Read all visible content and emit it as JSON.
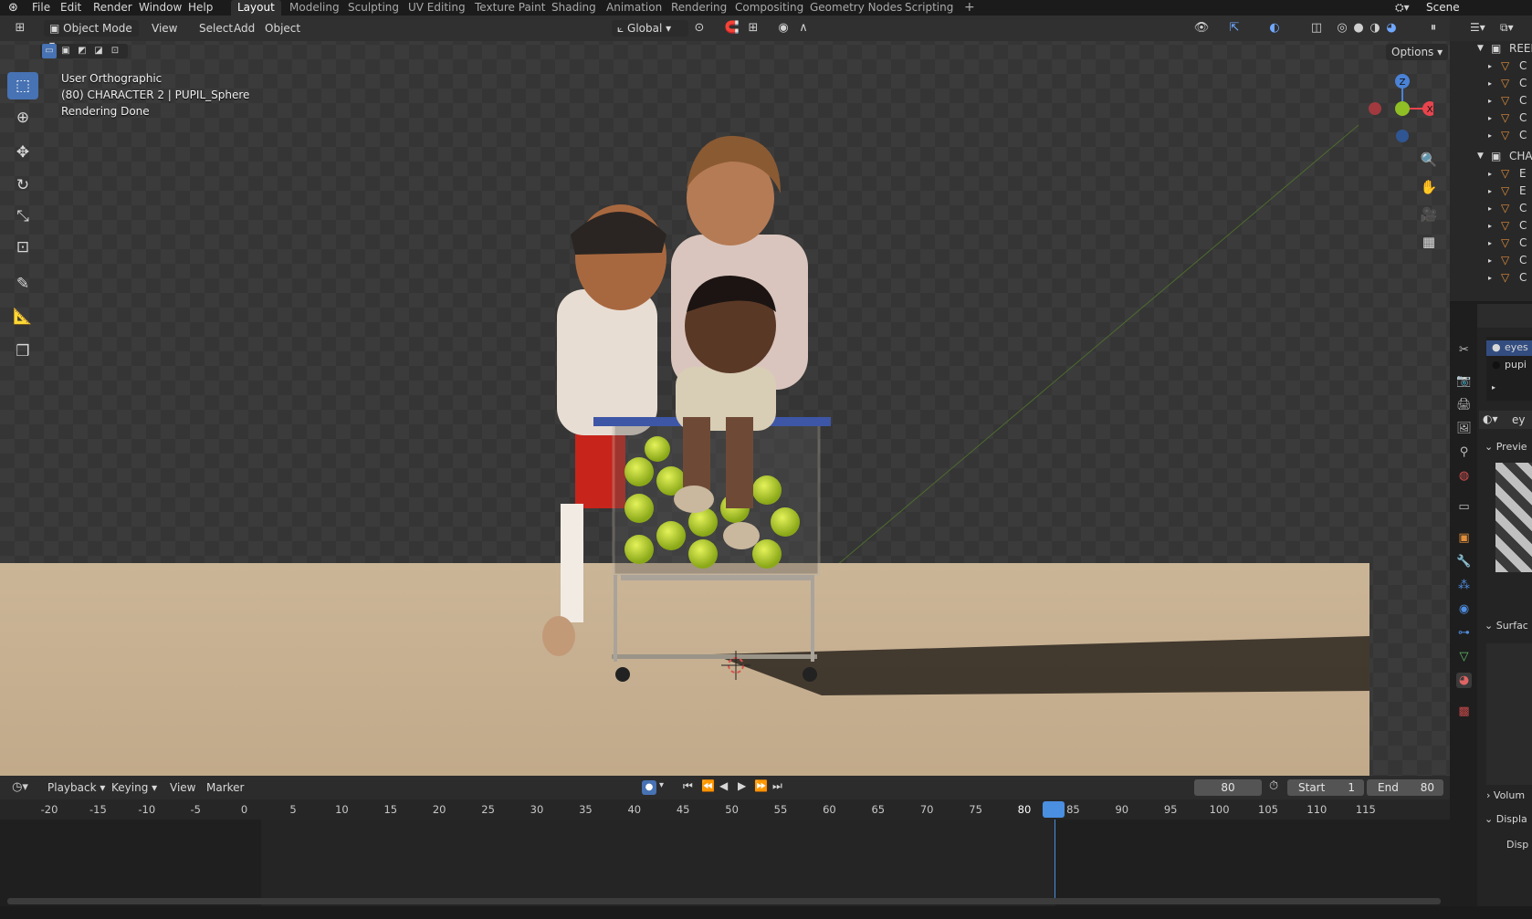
{
  "top_menu": {
    "items": [
      "File",
      "Edit",
      "Render",
      "Window",
      "Help"
    ],
    "workspace_tabs": [
      "Layout",
      "Modeling",
      "Sculpting",
      "UV Editing",
      "Texture Paint",
      "Shading",
      "Animation",
      "Rendering",
      "Compositing",
      "Geometry Nodes",
      "Scripting"
    ],
    "active_tab": "Layout",
    "add_tab": "+",
    "scene_label": "Scene"
  },
  "viewport_header": {
    "mode": "Object Mode",
    "menus": [
      "View",
      "Select",
      "Add",
      "Object"
    ],
    "orientation": "Global",
    "options_label": "Options"
  },
  "viewport_overlay": {
    "line1": "User Orthographic",
    "line2": "(80) CHARACTER 2 | PUPIL_Sphere",
    "line3": "Rendering Done"
  },
  "gizmo": {
    "z": "Z",
    "x": "X"
  },
  "timeline": {
    "menus": [
      "Playback",
      "Keying",
      "View",
      "Marker"
    ],
    "current_frame": "80",
    "start_label": "Start",
    "start_value": "1",
    "end_label": "End",
    "end_value": "80",
    "ticks": [
      "-20",
      "-15",
      "-10",
      "-5",
      "0",
      "5",
      "10",
      "15",
      "20",
      "25",
      "30",
      "35",
      "40",
      "45",
      "50",
      "55",
      "60",
      "65",
      "70",
      "75",
      "80",
      "85",
      "90",
      "95",
      "100",
      "105",
      "110",
      "115"
    ]
  },
  "outliner": {
    "collection_1": "REEB",
    "collection_2": "CHA",
    "object_initials_1": [
      "C",
      "C",
      "C",
      "C",
      "C"
    ],
    "object_initials_2": [
      "E",
      "E",
      "C",
      "C",
      "C",
      "C",
      "C"
    ]
  },
  "properties": {
    "material_slots": [
      "eyes",
      "pupi"
    ],
    "material_name": "ey",
    "sections": [
      "Previe",
      "Surfac",
      "Volum",
      "Displa",
      "Disp"
    ]
  },
  "colors": {
    "accent": "#4772b3",
    "axis_x": "#e8444d",
    "axis_y": "#8fbf25",
    "axis_z": "#4a82d6",
    "floor": "#c9b395",
    "playhead": "#4a8fe0"
  }
}
